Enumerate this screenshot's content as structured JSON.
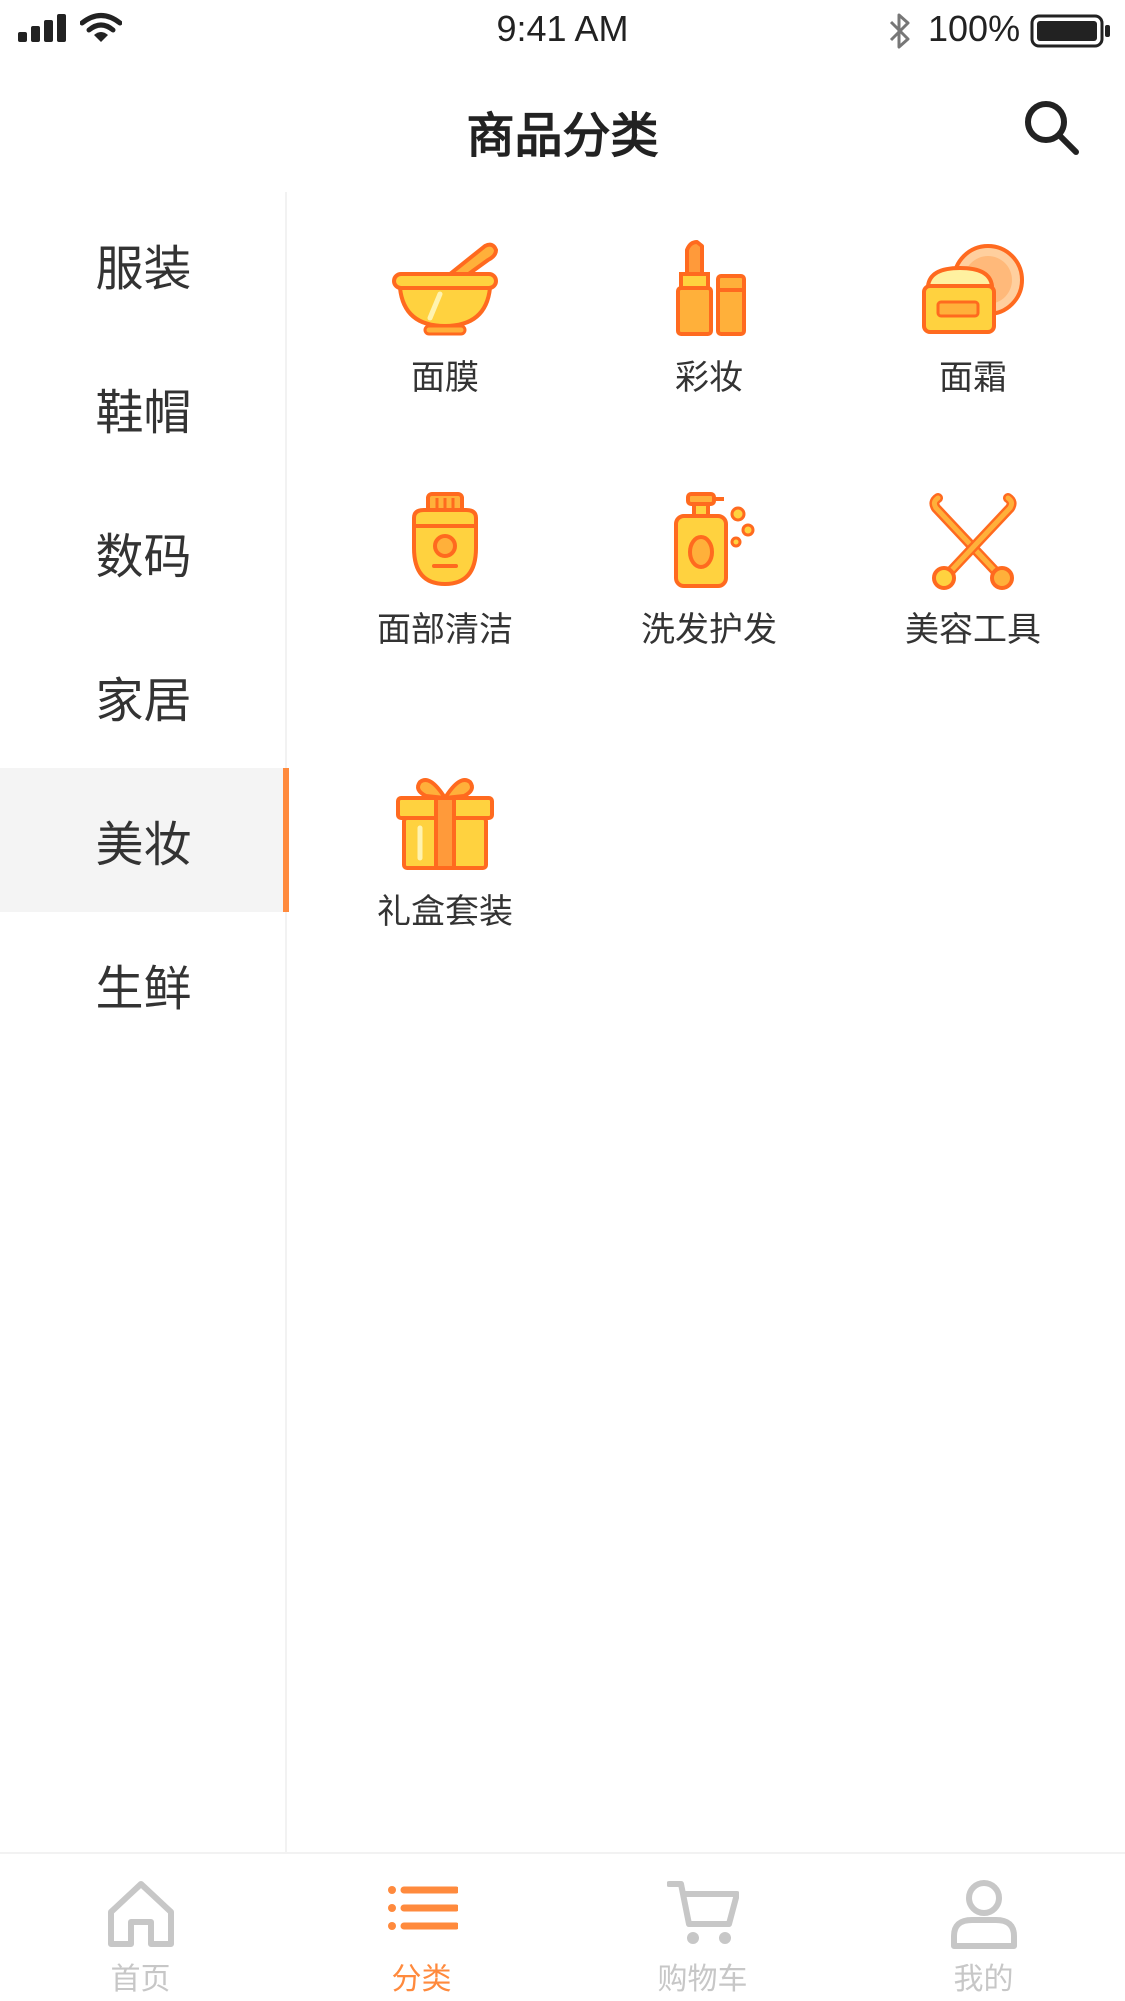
{
  "status_bar": {
    "time": "9:41 AM",
    "battery": "100%",
    "icons": [
      "signal-icon",
      "wifi-icon",
      "bluetooth-icon",
      "battery-icon"
    ]
  },
  "header": {
    "title": "商品分类",
    "search_icon": "search-icon"
  },
  "sidebar": {
    "items": [
      {
        "label": "服装"
      },
      {
        "label": "鞋帽"
      },
      {
        "label": "数码"
      },
      {
        "label": "家居"
      },
      {
        "label": "美妆",
        "active": true
      },
      {
        "label": "生鲜"
      }
    ]
  },
  "categories": [
    {
      "label": "面膜",
      "icon": "mortar-bowl-icon"
    },
    {
      "label": "彩妆",
      "icon": "lipstick-icon"
    },
    {
      "label": "面霜",
      "icon": "cream-jar-icon"
    },
    {
      "label": "面部清洁",
      "icon": "face-cleanser-icon"
    },
    {
      "label": "洗发护发",
      "icon": "shampoo-bottle-icon"
    },
    {
      "label": "美容工具",
      "icon": "beauty-tools-icon"
    },
    {
      "label": "礼盒套装",
      "icon": "gift-box-icon"
    }
  ],
  "tabbar": {
    "items": [
      {
        "label": "首页",
        "icon": "home-icon"
      },
      {
        "label": "分类",
        "icon": "list-icon",
        "active": true
      },
      {
        "label": "购物车",
        "icon": "cart-icon"
      },
      {
        "label": "我的",
        "icon": "user-icon"
      }
    ]
  },
  "colors": {
    "accent": "#ff8a3d",
    "icon_fill": "#ffd23f",
    "icon_stroke": "#ff6a1f",
    "inactive_tab": "#c7c7c7"
  }
}
